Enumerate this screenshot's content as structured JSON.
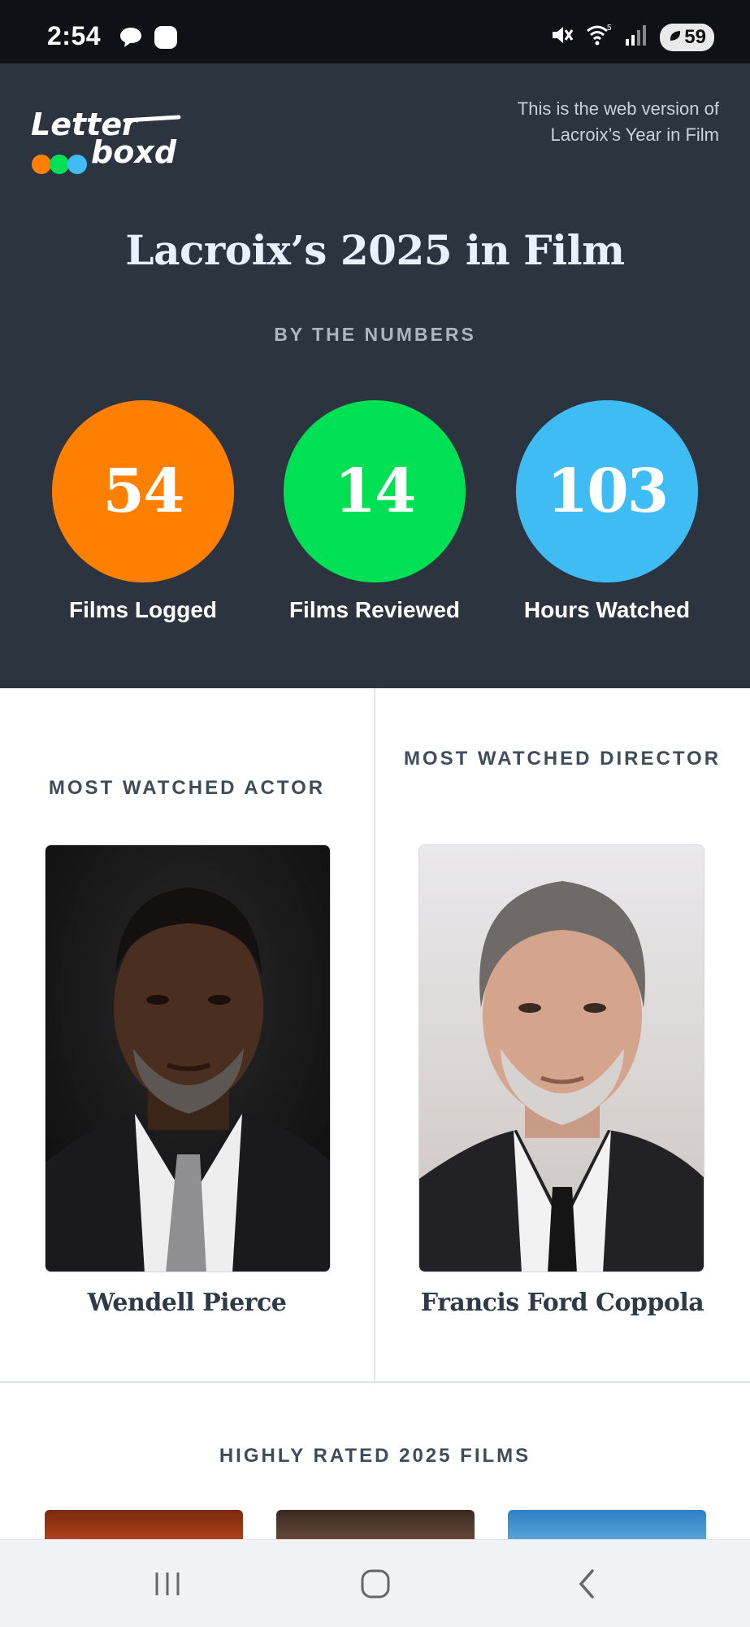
{
  "status_bar": {
    "time": "2:54",
    "battery": "59",
    "icons": [
      "chat-bubble-icon",
      "app-icon",
      "mute-icon",
      "wifi-icon",
      "signal-icon",
      "battery-icon"
    ]
  },
  "header": {
    "logo_line1": "Letter",
    "logo_line2": "boxd",
    "web_note": "This is the web version of Lacroix’s Year in Film",
    "title": "Lacroix’s 2025 in Film",
    "section_label": "BY THE NUMBERS"
  },
  "stats": [
    {
      "value": "54",
      "label": "Films Logged",
      "color": "#ff8000"
    },
    {
      "value": "14",
      "label": "Films Reviewed",
      "color": "#00e054"
    },
    {
      "value": "103",
      "label": "Hours Watched",
      "color": "#40bcf4"
    }
  ],
  "people": {
    "actor": {
      "heading": "MOST WATCHED ACTOR",
      "name": "Wendell Pierce"
    },
    "director": {
      "heading": "MOST WATCHED DIRECTOR",
      "name": "Francis Ford Coppola"
    }
  },
  "highly_rated": {
    "heading": "HIGHLY RATED 2025 FILMS"
  },
  "nav": {
    "icons": [
      "recent-apps-icon",
      "home-icon",
      "back-icon"
    ]
  },
  "colors": {
    "hero_bg": "#2c3440",
    "orange": "#ff8000",
    "green": "#00e054",
    "blue": "#40bcf4"
  }
}
